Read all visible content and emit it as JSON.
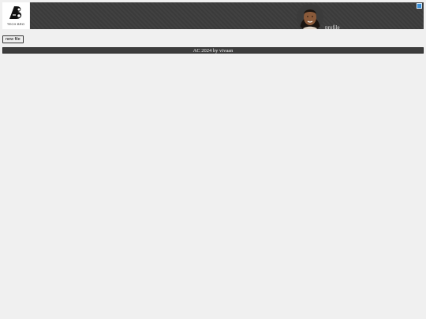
{
  "logo": {
    "text": "TECH BRO",
    "icon": "tech-bro-logo-icon"
  },
  "header": {
    "avatar_icon": "user-avatar-icon",
    "profile_label": "profile",
    "corner_icon": "external-link-icon"
  },
  "toolbar": {
    "new_file_label": "new file"
  },
  "footer": {
    "text": "AC 2024 by vivaan"
  },
  "colors": {
    "background": "#f0f0f0",
    "header_bar": "#3b3b3b",
    "footer_bar": "#3d3d3d",
    "corner_icon": "#3a8fd8"
  }
}
